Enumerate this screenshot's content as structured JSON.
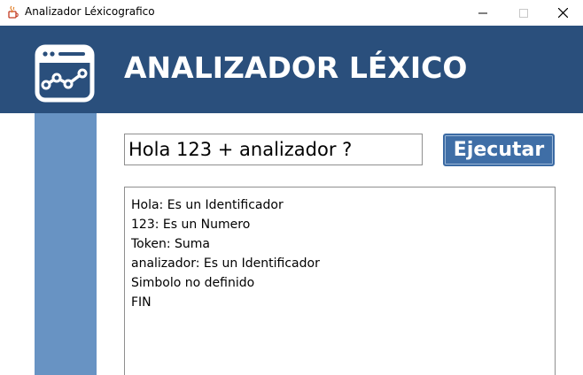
{
  "window": {
    "title": "Analizador Léxicografico",
    "app_icon": "java-cup-icon",
    "controls": {
      "minimize_icon": "minimize-icon",
      "maximize_icon": "maximize-icon",
      "close_icon": "close-icon"
    }
  },
  "header": {
    "icon": "browser-chart-icon",
    "title": "ANALIZADOR LÉXICO"
  },
  "input": {
    "value": "Hola 123 + analizador ?"
  },
  "button": {
    "label": "Ejecutar"
  },
  "output": {
    "lines": [
      "Hola: Es un Identificador",
      "123: Es un Numero",
      "Token: Suma",
      "analizador: Es un Identificador",
      "Simbolo no definido",
      "FIN"
    ]
  },
  "colors": {
    "header_bg": "#2a4f7c",
    "side_strip": "#6893c3",
    "button_bg": "#3f6ea6"
  }
}
